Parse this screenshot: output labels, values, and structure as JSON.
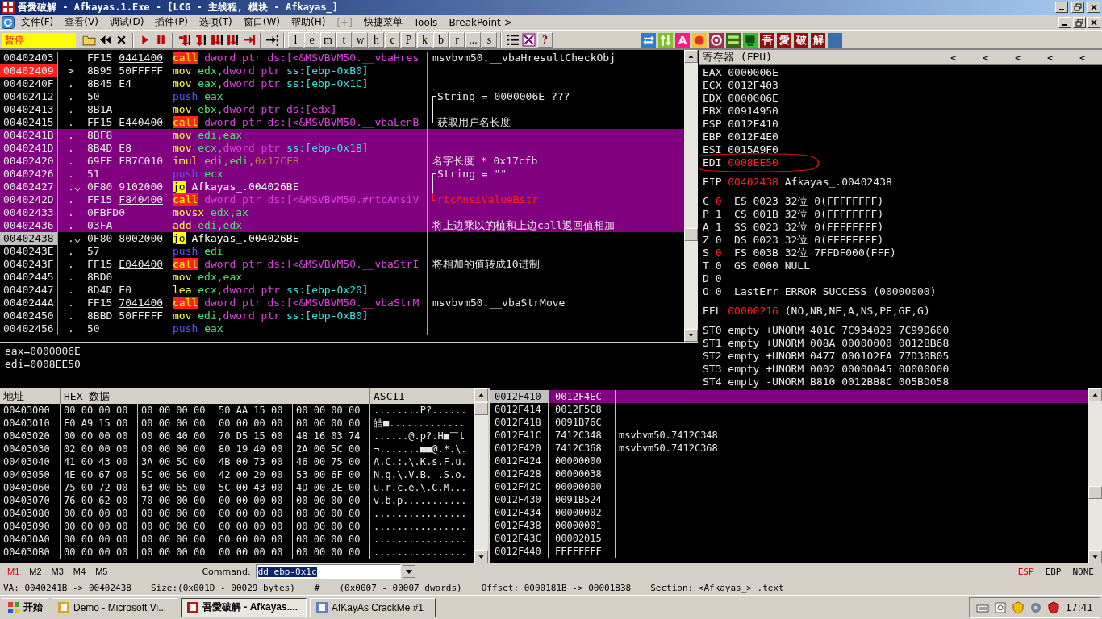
{
  "window": {
    "title": "吾愛破解 - Afkayas.1.Exe - [LCG -  主线程, 模块 - Afkayas_]"
  },
  "menu": [
    {
      "label": "文件(F)",
      "disabled": false
    },
    {
      "label": "查看(V)",
      "disabled": false
    },
    {
      "label": "调试(D)",
      "disabled": false
    },
    {
      "label": "插件(P)",
      "disabled": false
    },
    {
      "label": "选项(T)",
      "disabled": false
    },
    {
      "label": "窗口(W)",
      "disabled": false
    },
    {
      "label": "帮助(H)",
      "disabled": false
    },
    {
      "label": "[+]",
      "disabled": true
    },
    {
      "label": "快捷菜单",
      "disabled": false
    },
    {
      "label": "Tools",
      "disabled": false
    },
    {
      "label": "BreakPoint->",
      "disabled": false
    }
  ],
  "toolbar": {
    "status": "暂停",
    "letter_buttons": [
      "l",
      "e",
      "m",
      "t",
      "w",
      "h",
      "c",
      "P",
      "k",
      "b",
      "r",
      "...",
      "s"
    ],
    "help_label": "?",
    "plugin_labels": [
      "A",
      "吾",
      "愛",
      "破",
      "解"
    ]
  },
  "disassembly": {
    "rows": [
      {
        "address": "00402403",
        "marker": ".",
        "jump": false,
        "hex": [
          "FF15",
          "0441400"
        ],
        "fixup": true,
        "code": {
          "kind": "call",
          "mnemonic": "call",
          "operands": [
            {
              "kind": "size",
              "text": "dword ptr"
            },
            {
              "kind": "ds",
              "text": "ds:[<&MSVBVM50.__vbaHres"
            }
          ]
        },
        "comment": "msvbvm50.__vbaHresultCheckObj",
        "selected": false,
        "breakpoint": false,
        "current": false
      },
      {
        "address": "00402409",
        "marker": ">",
        "jump": false,
        "hex": [
          "8B95",
          "50FFFFF"
        ],
        "fixup": false,
        "code": {
          "kind": "op",
          "mnemonic": "mov",
          "operands": [
            {
              "kind": "reg",
              "text": "edx,"
            },
            {
              "kind": "size",
              "text": "dword ptr"
            },
            {
              "kind": "ss",
              "text": "ss:[ebp-0xB0]"
            }
          ]
        },
        "selected": false,
        "breakpoint": true,
        "current": false
      },
      {
        "address": "0040240F",
        "marker": ".",
        "jump": false,
        "hex": [
          "8B45",
          "E4"
        ],
        "fixup": false,
        "code": {
          "kind": "op",
          "mnemonic": "mov",
          "operands": [
            {
              "kind": "reg",
              "text": "eax,"
            },
            {
              "kind": "size",
              "text": "dword ptr"
            },
            {
              "kind": "ss",
              "text": "ss:[ebp-0x1C]"
            }
          ]
        },
        "selected": false,
        "breakpoint": false,
        "current": false
      },
      {
        "address": "00402412",
        "marker": ".",
        "jump": false,
        "hex": [
          "50"
        ],
        "fixup": false,
        "code": {
          "kind": "push",
          "mnemonic": "push",
          "operands": [
            {
              "kind": "reg",
              "text": "eax"
            }
          ]
        },
        "kind": "bracket-top",
        "comment": "String = 0000006E ???",
        "selected": false,
        "breakpoint": false,
        "current": false
      },
      {
        "address": "00402413",
        "marker": ".",
        "jump": false,
        "hex": [
          "8B1A"
        ],
        "fixup": false,
        "code": {
          "kind": "op",
          "mnemonic": "mov",
          "operands": [
            {
              "kind": "reg",
              "text": "ebx,"
            },
            {
              "kind": "size",
              "text": "dword ptr"
            },
            {
              "kind": "ds",
              "text": "ds:[edx]"
            }
          ]
        },
        "kind": "bracket-mid",
        "selected": false,
        "breakpoint": false,
        "current": false
      },
      {
        "address": "00402415",
        "marker": ".",
        "jump": false,
        "hex": [
          "FF15",
          "E440400"
        ],
        "fixup": true,
        "code": {
          "kind": "call",
          "mnemonic": "call",
          "operands": [
            {
              "kind": "size",
              "text": "dword ptr"
            },
            {
              "kind": "ds",
              "text": "ds:[<&MSVBVM50.__vbaLenB"
            }
          ]
        },
        "kind": "bracket-end",
        "comment": "获取用户名长度",
        "selected": false,
        "breakpoint": false,
        "current": false
      },
      {
        "address": "0040241B",
        "marker": ".",
        "jump": false,
        "hex": [
          "8BF8"
        ],
        "fixup": false,
        "code": {
          "kind": "op",
          "mnemonic": "mov",
          "operands": [
            {
              "kind": "reg",
              "text": "edi,eax"
            }
          ]
        },
        "selected": true,
        "breakpoint": false,
        "current": false
      },
      {
        "address": "0040241D",
        "marker": ".",
        "jump": false,
        "hex": [
          "8B4D",
          "E8"
        ],
        "fixup": false,
        "code": {
          "kind": "op",
          "mnemonic": "mov",
          "operands": [
            {
              "kind": "reg",
              "text": "ecx,"
            },
            {
              "kind": "size",
              "text": "dword ptr"
            },
            {
              "kind": "ss",
              "text": "ss:[ebp-0x18]"
            }
          ]
        },
        "selected": true,
        "breakpoint": false,
        "current": false
      },
      {
        "address": "00402420",
        "marker": ".",
        "jump": false,
        "hex": [
          "69FF",
          "FB7C010"
        ],
        "fixup": false,
        "code": {
          "kind": "op",
          "mnemonic": "imul",
          "operands": [
            {
              "kind": "reg",
              "text": "edi,edi,"
            },
            {
              "kind": "imm",
              "text": "0x17CFB"
            }
          ]
        },
        "comment": "名字长度 * 0x17cfb",
        "selected": true,
        "breakpoint": false,
        "current": false
      },
      {
        "address": "00402426",
        "marker": ".",
        "jump": false,
        "hex": [
          "51"
        ],
        "fixup": false,
        "code": {
          "kind": "push",
          "mnemonic": "push",
          "operands": [
            {
              "kind": "reg",
              "text": "ecx"
            }
          ]
        },
        "kind": "bracket-top",
        "comment": "String = \"\"",
        "selected": true,
        "breakpoint": false,
        "current": false
      },
      {
        "address": "00402427",
        "marker": ".",
        "jump": true,
        "hex": [
          "0F80",
          "9102000"
        ],
        "fixup": false,
        "code": {
          "kind": "jump",
          "mnemonic": "jo",
          "operands": [
            {
              "kind": "label",
              "text": "Afkayas_.004026BE"
            }
          ]
        },
        "kind": "bracket-mid",
        "selected": true,
        "breakpoint": false,
        "current": false
      },
      {
        "address": "0040242D",
        "marker": ".",
        "jump": false,
        "hex": [
          "FF15",
          "F840400"
        ],
        "fixup": true,
        "code": {
          "kind": "call",
          "mnemonic": "call",
          "operands": [
            {
              "kind": "size",
              "text": "dword ptr"
            },
            {
              "kind": "ds",
              "text": "ds:[<&MSVBVM50.#rtcAnsiV"
            }
          ]
        },
        "kind": "bracket-end",
        "comment": "rtcAnsiValueBstr",
        "comment_alert": true,
        "selected": true,
        "breakpoint": false,
        "current": false
      },
      {
        "address": "00402433",
        "marker": ".",
        "jump": false,
        "hex": [
          "0FBFD0"
        ],
        "fixup": false,
        "code": {
          "kind": "op",
          "mnemonic": "movsx",
          "operands": [
            {
              "kind": "reg",
              "text": "edx,ax"
            }
          ]
        },
        "selected": true,
        "breakpoint": false,
        "current": false
      },
      {
        "address": "00402436",
        "marker": ".",
        "jump": false,
        "hex": [
          "03FA"
        ],
        "fixup": false,
        "code": {
          "kind": "op",
          "mnemonic": "add",
          "operands": [
            {
              "kind": "reg",
              "text": "edi,edx"
            }
          ]
        },
        "comment": "将上边乘以的植和上边call返回值相加",
        "selected": true,
        "breakpoint": false,
        "current": false
      },
      {
        "address": "00402438",
        "marker": ".",
        "jump": true,
        "hex": [
          "0F80",
          "8002000"
        ],
        "fixup": false,
        "code": {
          "kind": "jump",
          "mnemonic": "jo",
          "operands": [
            {
              "kind": "label",
              "text": "Afkayas_.004026BE"
            }
          ]
        },
        "selected": false,
        "breakpoint": false,
        "current": true
      },
      {
        "address": "0040243E",
        "marker": ".",
        "jump": false,
        "hex": [
          "57"
        ],
        "fixup": false,
        "code": {
          "kind": "push",
          "mnemonic": "push",
          "operands": [
            {
              "kind": "reg",
              "text": "edi"
            }
          ]
        },
        "selected": false,
        "breakpoint": false,
        "current": false
      },
      {
        "address": "0040243F",
        "marker": ".",
        "jump": false,
        "hex": [
          "FF15",
          "E040400"
        ],
        "fixup": true,
        "code": {
          "kind": "call",
          "mnemonic": "call",
          "operands": [
            {
              "kind": "size",
              "text": "dword ptr"
            },
            {
              "kind": "ds",
              "text": "ds:[<&MSVBVM50.__vbaStrI"
            }
          ]
        },
        "comment": "将相加的值转成10进制",
        "selected": false,
        "breakpoint": false,
        "current": false
      },
      {
        "address": "00402445",
        "marker": ".",
        "jump": false,
        "hex": [
          "8BD0"
        ],
        "fixup": false,
        "code": {
          "kind": "op",
          "mnemonic": "mov",
          "operands": [
            {
              "kind": "reg",
              "text": "edx,eax"
            }
          ]
        },
        "selected": false,
        "breakpoint": false,
        "current": false
      },
      {
        "address": "00402447",
        "marker": ".",
        "jump": false,
        "hex": [
          "8D4D",
          "E0"
        ],
        "fixup": false,
        "code": {
          "kind": "op",
          "mnemonic": "lea",
          "operands": [
            {
              "kind": "reg",
              "text": "ecx,"
            },
            {
              "kind": "size",
              "text": "dword ptr"
            },
            {
              "kind": "ss",
              "text": "ss:[ebp-0x20]"
            }
          ]
        },
        "selected": false,
        "breakpoint": false,
        "current": false
      },
      {
        "address": "0040244A",
        "marker": ".",
        "jump": false,
        "hex": [
          "FF15",
          "7041400"
        ],
        "fixup": true,
        "code": {
          "kind": "call",
          "mnemonic": "call",
          "operands": [
            {
              "kind": "size",
              "text": "dword ptr"
            },
            {
              "kind": "ds",
              "text": "ds:[<&MSVBVM50.__vbaStrM"
            }
          ]
        },
        "comment": "msvbvm50.__vbaStrMove",
        "selected": false,
        "breakpoint": false,
        "current": false
      },
      {
        "address": "00402450",
        "marker": ".",
        "jump": false,
        "hex": [
          "8BBD",
          "50FFFFF"
        ],
        "fixup": false,
        "code": {
          "kind": "op",
          "mnemonic": "mov",
          "operands": [
            {
              "kind": "reg",
              "text": "edi,"
            },
            {
              "kind": "size",
              "text": "dword ptr"
            },
            {
              "kind": "ss",
              "text": "ss:[ebp-0xB0]"
            }
          ]
        },
        "selected": false,
        "breakpoint": false,
        "current": false
      },
      {
        "address": "00402456",
        "marker": ".",
        "jump": false,
        "hex": [
          "50"
        ],
        "fixup": false,
        "code": {
          "kind": "push",
          "mnemonic": "push",
          "operands": [
            {
              "kind": "reg",
              "text": "eax"
            }
          ]
        },
        "selected": false,
        "breakpoint": false,
        "current": false
      }
    ],
    "info": [
      "eax=0000006E",
      "edi=0008EE50"
    ]
  },
  "registers": {
    "title": "寄存器 (FPU)",
    "nav_buttons": [
      "<",
      "<",
      "<",
      "<",
      "<"
    ],
    "general": [
      {
        "name": "EAX",
        "value": "0000006E",
        "changed": false,
        "annotated": false
      },
      {
        "name": "ECX",
        "value": "0012F403",
        "changed": false,
        "annotated": false
      },
      {
        "name": "EDX",
        "value": "0000006E",
        "changed": false,
        "annotated": false
      },
      {
        "name": "EBX",
        "value": "00914950",
        "changed": false,
        "annotated": false
      },
      {
        "name": "ESP",
        "value": "0012F410",
        "changed": false,
        "annotated": false
      },
      {
        "name": "EBP",
        "value": "0012F4E0",
        "changed": false,
        "annotated": false
      },
      {
        "name": "ESI",
        "value": "0015A9F0",
        "changed": false,
        "annotated": false
      },
      {
        "name": "EDI",
        "value": "0008EE50",
        "changed": true,
        "annotated": true
      }
    ],
    "eip": {
      "name": "EIP",
      "value": "00402438",
      "changed": true,
      "comment": "Afkayas_.00402438"
    },
    "flags": [
      {
        "name": "C",
        "value": "0",
        "changed": true,
        "detail": "ES 0023 32位 0(FFFFFFFF)"
      },
      {
        "name": "P",
        "value": "1",
        "changed": false,
        "detail": "CS 001B 32位 0(FFFFFFFF)"
      },
      {
        "name": "A",
        "value": "1",
        "changed": false,
        "detail": "SS 0023 32位 0(FFFFFFFF)"
      },
      {
        "name": "Z",
        "value": "0",
        "changed": false,
        "detail": "DS 0023 32位 0(FFFFFFFF)"
      },
      {
        "name": "S",
        "value": "0",
        "changed": true,
        "detail": "FS 003B 32位 7FFDF000(FFF)"
      },
      {
        "name": "T",
        "value": "0",
        "changed": false,
        "detail": "GS 0000 NULL"
      },
      {
        "name": "D",
        "value": "0",
        "changed": false
      },
      {
        "name": "O",
        "value": "0",
        "changed": false,
        "detail": "LastErr ERROR_SUCCESS (00000000)"
      }
    ],
    "efl": {
      "name": "EFL",
      "value": "00000216",
      "changed": true,
      "decoded": "(NO,NB,NE,A,NS,PE,GE,G)"
    },
    "fpu": [
      "ST0 empty +UNORM 401C 7C934029 7C99D600",
      "ST1 empty +UNORM 008A 00000000 0012BB68",
      "ST2 empty +UNORM 0477 000102FA 77D30B05",
      "ST3 empty +UNORM 0002 00000045 00000000",
      "ST4 empty -UNORM B810 0012BB8C 005BD058"
    ]
  },
  "dump": {
    "headers": [
      "地址",
      "HEX 数据",
      "ASCII"
    ],
    "rows": [
      {
        "address": "00403000",
        "groups": [
          "00 00 00 00",
          "00 00 00 00",
          "50 AA 15 00",
          "00 00 00 00"
        ],
        "ascii": "........P?......"
      },
      {
        "address": "00403010",
        "groups": [
          "F0 A9 15 00",
          "00 00 00 00",
          "00 00 00 00",
          "00 00 00 00"
        ],
        "ascii": "皓■............."
      },
      {
        "address": "00403020",
        "groups": [
          "00 00 00 00",
          "00 00 40 00",
          "70 D5 15 00",
          "48 16 03 74"
        ],
        "ascii": "......@.p?.H■￣t"
      },
      {
        "address": "00403030",
        "groups": [
          "02 00 00 00",
          "00 00 00 00",
          "80 19 40 00",
          "2A 00 5C 00"
        ],
        "ascii": "¬.......■■@.*.\\."
      },
      {
        "address": "00403040",
        "groups": [
          "41 00 43 00",
          "3A 00 5C 00",
          "4B 00 73 00",
          "46 00 75 00"
        ],
        "ascii": "A.C.:.\\.K.s.F.u."
      },
      {
        "address": "00403050",
        "groups": [
          "4E 00 67 00",
          "5C 00 56 00",
          "42 00 20 00",
          "53 00 6F 00"
        ],
        "ascii": "N.g.\\.V.B. .S.o."
      },
      {
        "address": "00403060",
        "groups": [
          "75 00 72 00",
          "63 00 65 00",
          "5C 00 43 00",
          "4D 00 2E 00"
        ],
        "ascii": "u.r.c.e.\\.C.M..."
      },
      {
        "address": "00403070",
        "groups": [
          "76 00 62 00",
          "70 00 00 00",
          "00 00 00 00",
          "00 00 00 00"
        ],
        "ascii": "v.b.p..........."
      },
      {
        "address": "00403080",
        "groups": [
          "00 00 00 00",
          "00 00 00 00",
          "00 00 00 00",
          "00 00 00 00"
        ],
        "ascii": "................"
      },
      {
        "address": "00403090",
        "groups": [
          "00 00 00 00",
          "00 00 00 00",
          "00 00 00 00",
          "00 00 00 00"
        ],
        "ascii": "................"
      },
      {
        "address": "004030A0",
        "groups": [
          "00 00 00 00",
          "00 00 00 00",
          "00 00 00 00",
          "00 00 00 00"
        ],
        "ascii": "................"
      },
      {
        "address": "004030B0",
        "groups": [
          "00 00 00 00",
          "00 00 00 00",
          "00 00 00 00",
          "00 00 00 00"
        ],
        "ascii": "................"
      }
    ]
  },
  "stack": {
    "rows": [
      {
        "address": "0012F410",
        "value": "0012F4EC",
        "selected": true
      },
      {
        "address": "0012F414",
        "value": "0012F5C8",
        "selected": false
      },
      {
        "address": "0012F418",
        "value": "0091B76C",
        "selected": false
      },
      {
        "address": "0012F41C",
        "value": "7412C348",
        "comment": "msvbvm50.7412C348",
        "selected": false
      },
      {
        "address": "0012F420",
        "value": "7412C368",
        "comment": "msvbvm50.7412C368",
        "selected": false
      },
      {
        "address": "0012F424",
        "value": "00000000",
        "selected": false
      },
      {
        "address": "0012F428",
        "value": "00000038",
        "selected": false
      },
      {
        "address": "0012F42C",
        "value": "00000000",
        "selected": false
      },
      {
        "address": "0012F430",
        "value": "0091B524",
        "selected": false
      },
      {
        "address": "0012F434",
        "value": "00000002",
        "selected": false
      },
      {
        "address": "0012F438",
        "value": "00000001",
        "selected": false
      },
      {
        "address": "0012F43C",
        "value": "00002015",
        "selected": false
      },
      {
        "address": "0012F440",
        "value": "FFFFFFFF",
        "selected": false
      }
    ]
  },
  "command_bar": {
    "markers": [
      {
        "label": "M1",
        "selected": true
      },
      {
        "label": "M2",
        "selected": false
      },
      {
        "label": "M3",
        "selected": false
      },
      {
        "label": "M4",
        "selected": false
      },
      {
        "label": "M5",
        "selected": false
      }
    ],
    "label": "Command:",
    "value": "dd ebp-0x1c",
    "stack_modes": [
      {
        "label": "ESP",
        "selected": true
      },
      {
        "label": "EBP",
        "selected": false
      },
      {
        "label": "NONE",
        "selected": false
      }
    ]
  },
  "status_bar": [
    "VA: 0040241B -> 00402438",
    "Size:(0x001D - 00029 bytes)",
    "#",
    "(0x0007 - 00007 dwords)",
    "Offset: 0000181B -> 00001838",
    "Section: <Afkayas_> .text"
  ],
  "taskbar": {
    "start": "开始",
    "tasks": [
      {
        "label": "Demo - Microsoft Vi...",
        "selected": false
      },
      {
        "label": "吾愛破解 - Afkayas....",
        "selected": true
      },
      {
        "label": "AfKayAs CrackMe #1",
        "selected": false
      }
    ],
    "clock": "17:41"
  }
}
